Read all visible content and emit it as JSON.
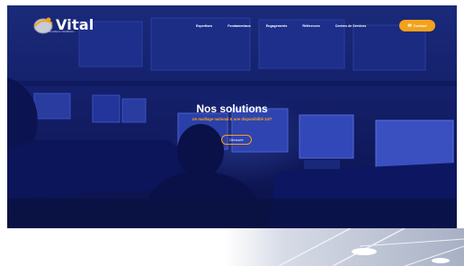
{
  "brand": {
    "name": "Vital",
    "tagline": "Surveillance Télédiffusion"
  },
  "nav": {
    "items": [
      {
        "label": "Expertises"
      },
      {
        "label": "Fondamentaux"
      },
      {
        "label": "Engagements"
      },
      {
        "label": "Références"
      },
      {
        "label": "Centres de Services"
      }
    ],
    "contact_label": "Contact"
  },
  "hero": {
    "title": "Nos solutions",
    "subtitle": "Un maillage national & une disponibilité 24/7",
    "cta_label": "Découvrir"
  },
  "colors": {
    "accent": "#f4a21a",
    "hero_overlay": "#14206a"
  }
}
